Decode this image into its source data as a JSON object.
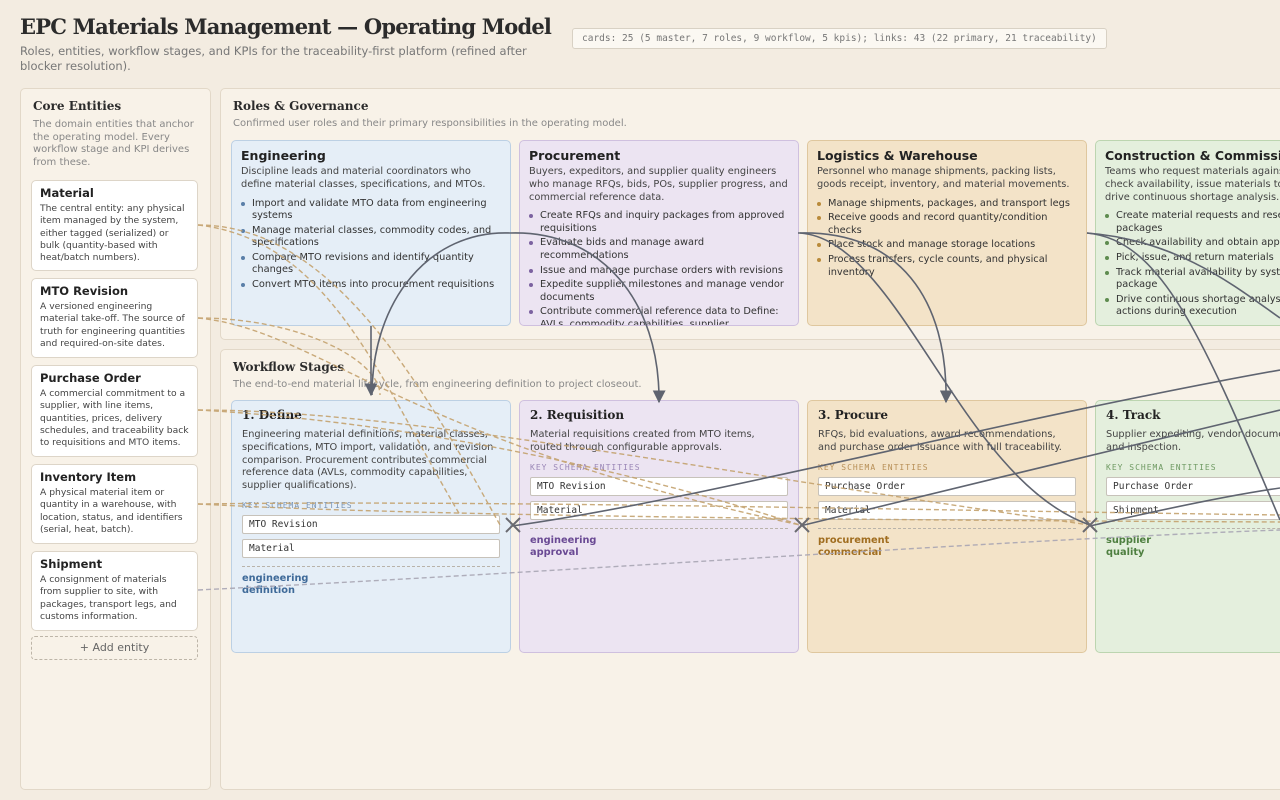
{
  "header": {
    "title": "EPC Materials Management — Operating Model",
    "subtitle": "Roles, entities, workflow stages, and KPIs for the traceability-first platform (refined after blocker resolution).",
    "stats": "cards: 25 (5 master, 7 roles, 9 workflow, 5 kpis); links: 43 (22 primary, 21 traceability)"
  },
  "entities": {
    "title": "Core Entities",
    "description": "The domain entities that anchor the operating model. Every workflow stage and KPI derives from these.",
    "items": [
      {
        "name": "Material",
        "description": "The central entity: any physical item managed by the system, either tagged (serialized) or bulk (quantity-based with heat/batch numbers)."
      },
      {
        "name": "MTO Revision",
        "description": "A versioned engineering material take-off. The source of truth for engineering quantities and required-on-site dates."
      },
      {
        "name": "Purchase Order",
        "description": "A commercial commitment to a supplier, with line items, quantities, prices, delivery schedules, and traceability back to requisitions and MTO items."
      },
      {
        "name": "Inventory Item",
        "description": "A physical material item or quantity in a warehouse, with location, status, and identifiers (serial, heat, batch)."
      },
      {
        "name": "Shipment",
        "description": "A consignment of materials from supplier to site, with packages, transport legs, and customs information."
      }
    ],
    "add_label": "+ Add entity"
  },
  "roles": {
    "title": "Roles & Governance",
    "description": "Confirmed user roles and their primary responsibilities in the operating model.",
    "items": [
      {
        "name": "Engineering",
        "description": "Discipline leads and material coordinators who define material classes, specifications, and MTOs.",
        "responsibilities": [
          "Import and validate MTO data from engineering systems",
          "Manage material classes, commodity codes, and specifications",
          "Compare MTO revisions and identify quantity changes",
          "Convert MTO items into procurement requisitions"
        ]
      },
      {
        "name": "Procurement",
        "description": "Buyers, expeditors, and supplier quality engineers who manage RFQs, bids, POs, supplier progress, and commercial reference data.",
        "responsibilities": [
          "Create RFQs and inquiry packages from approved requisitions",
          "Evaluate bids and manage award recommendations",
          "Issue and manage purchase orders with revisions",
          "Expedite supplier milestones and manage vendor documents",
          "Contribute commercial reference data to Define: AVLs, commodity capabilities, supplier qualifications"
        ]
      },
      {
        "name": "Logistics & Warehouse",
        "description": "Personnel who manage shipments, packing lists, goods receipt, inventory, and material movements.",
        "responsibilities": [
          "Manage shipments, packages, and transport legs",
          "Receive goods and record quantity/condition checks",
          "Place stock and manage storage locations",
          "Process transfers, cycle counts, and physical inventory"
        ]
      },
      {
        "name": "Construction & Commissioning",
        "description": "Teams who request materials against work packs, check availability, issue materials to work fronts, and drive continuous shortage analysis.",
        "responsibilities": [
          "Create material requests and reserve stock for work packages",
          "Check availability and obtain approvals",
          "Pick, issue, and return materials",
          "Track material availability by system and work package",
          "Drive continuous shortage analysis and mitigation actions during execution"
        ]
      }
    ]
  },
  "workflow": {
    "title": "Workflow Stages",
    "description": "The end-to-end material lifecycle, from engineering definition to project closeout.",
    "schema_label": "KEY SCHEMA ENTITIES",
    "stages": [
      {
        "name": "1. Define",
        "description": "Engineering material definitions, material classes, specifications, MTO import, validation, and revision comparison. Procurement contributes commercial reference data (AVLs, commodity capabilities, supplier qualifications).",
        "entities": [
          "MTO Revision",
          "Material"
        ],
        "tags": [
          "engineering",
          "definition"
        ]
      },
      {
        "name": "2. Requisition",
        "description": "Material requisitions created from MTO items, routed through configurable approvals.",
        "entities": [
          "MTO Revision",
          "Material"
        ],
        "tags": [
          "engineering",
          "approval"
        ]
      },
      {
        "name": "3. Procure",
        "description": "RFQs, bid evaluations, award recommendations, and purchase order issuance with full traceability.",
        "entities": [
          "Purchase Order",
          "Material"
        ],
        "tags": [
          "procurement",
          "commercial"
        ]
      },
      {
        "name": "4. Track",
        "description": "Supplier expediting, vendor document surveillance, and inspection.",
        "entities": [
          "Purchase Order",
          "Shipment"
        ],
        "tags": [
          "supplier",
          "quality"
        ]
      }
    ]
  },
  "colors": {
    "engineering": "#e5eef7",
    "procurement": "#ece4f2",
    "logistics": "#f3e3c8",
    "construction": "#e4efdd",
    "primary_link": "#5f6470",
    "traceability_link": "#c4a26e"
  }
}
